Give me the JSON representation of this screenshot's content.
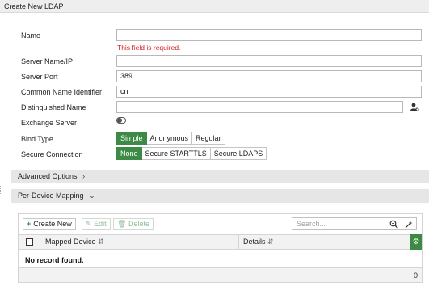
{
  "window": {
    "title": "Create New LDAP"
  },
  "form": {
    "name": {
      "label": "Name",
      "value": "",
      "error": "This field is required."
    },
    "server": {
      "label": "Server Name/IP",
      "value": ""
    },
    "port": {
      "label": "Server Port",
      "value": "389"
    },
    "cn": {
      "label": "Common Name Identifier",
      "value": "cn"
    },
    "dn": {
      "label": "Distinguished Name",
      "value": ""
    },
    "exchange": {
      "label": "Exchange Server",
      "enabled": false
    },
    "bind": {
      "label": "Bind Type",
      "options": [
        "Simple",
        "Anonymous",
        "Regular"
      ],
      "selected": "Simple"
    },
    "secure": {
      "label": "Secure Connection",
      "options": [
        "None",
        "Secure STARTTLS",
        "Secure LDAPS"
      ],
      "selected": "None"
    }
  },
  "sections": {
    "advanced": {
      "label": "Advanced Options",
      "chevron": "chevron-right-icon"
    },
    "mapping": {
      "label": "Per-Device Mapping",
      "chevron": "chevron-down-icon"
    }
  },
  "mapping_table": {
    "toolbar": {
      "create": "Create New",
      "edit": "Edit",
      "delete": "Delete"
    },
    "search": {
      "placeholder": "Search..."
    },
    "columns": [
      "Mapped Device",
      "Details"
    ],
    "empty": "No record found.",
    "count": "0"
  },
  "colors": {
    "accent": "#3c8a46",
    "error": "#d42121"
  }
}
